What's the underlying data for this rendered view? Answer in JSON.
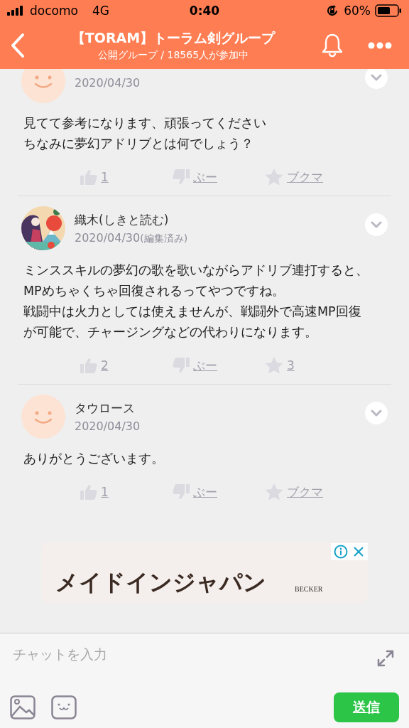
{
  "status_bar": {
    "carrier": "docomo",
    "network": "4G",
    "time": "0:40",
    "battery": "60%"
  },
  "header": {
    "title": "【TORAM】トーラム剣グループ",
    "subtitle": "公開グループ / 18565人が参加中"
  },
  "comments": [
    {
      "avatar": {
        "kind": "smiley"
      },
      "date": "2020/04/30",
      "text": [
        "見てて参考になります、頑張ってください",
        "ちなみに夢幻アドリブとは何でしょう？"
      ],
      "likes": "1",
      "dislike": "ぶー",
      "bookmark": "ブクマ"
    },
    {
      "avatar": {
        "kind": "picture"
      },
      "name": "織木(しきと読む)",
      "date": "2020/04/30",
      "edited": "(編集済み)",
      "text": [
        "ミンススキルの夢幻の歌を歌いながらアドリブ連打すると、MPめちゃくちゃ回復されるってやつですね。",
        "戦闘中は火力としては使えませんが、戦闘外で高速MP回復が可能で、チャージングなどの代わりになります。"
      ],
      "likes": "2",
      "dislike": "ぶー",
      "bookmark": "3"
    },
    {
      "avatar": {
        "kind": "smiley"
      },
      "name": "タウロース",
      "date": "2020/04/30",
      "text": [
        "ありがとうございます。"
      ],
      "likes": "1",
      "dislike": "ぶー",
      "bookmark": "ブクマ"
    }
  ],
  "ad": {
    "headline": "メイドインジャパン",
    "brand": "BECKER"
  },
  "composer": {
    "placeholder": "チャットを入力",
    "send": "送信"
  }
}
